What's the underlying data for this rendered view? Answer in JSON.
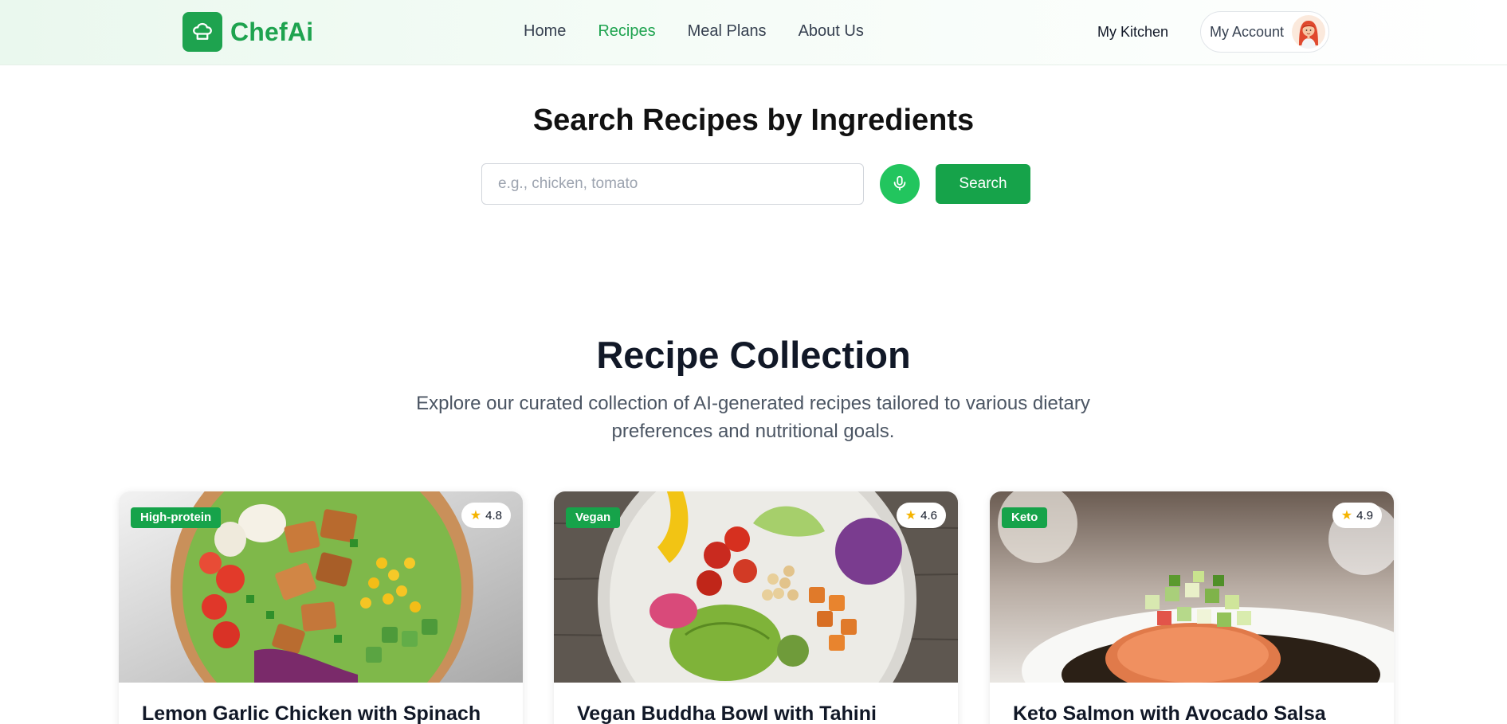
{
  "brand": {
    "name": "ChefAi",
    "logo_icon": "chef-hat-icon"
  },
  "nav": [
    {
      "label": "Home",
      "active": false
    },
    {
      "label": "Recipes",
      "active": true
    },
    {
      "label": "Meal Plans",
      "active": false
    },
    {
      "label": "About Us",
      "active": false
    }
  ],
  "header": {
    "kitchen_label": "My Kitchen",
    "account_label": "My Account"
  },
  "search": {
    "title": "Search Recipes by Ingredients",
    "placeholder": "e.g., chicken, tomato",
    "value": "",
    "mic_icon": "microphone-icon",
    "button_label": "Search"
  },
  "collection": {
    "title": "Recipe Collection",
    "subtitle": "Explore our curated collection of AI-generated recipes tailored to various dietary preferences and nutritional goals."
  },
  "recipes": [
    {
      "tag": "High-protein",
      "rating": "4.8",
      "title": "Lemon Garlic Chicken with Spinach"
    },
    {
      "tag": "Vegan",
      "rating": "4.6",
      "title": "Vegan Buddha Bowl with Tahini"
    },
    {
      "tag": "Keto",
      "rating": "4.9",
      "title": "Keto Salmon with Avocado Salsa"
    }
  ],
  "colors": {
    "brand_green": "#1ea34f",
    "button_green": "#16a34a",
    "mic_green": "#22c55e",
    "star": "#f5b400"
  }
}
